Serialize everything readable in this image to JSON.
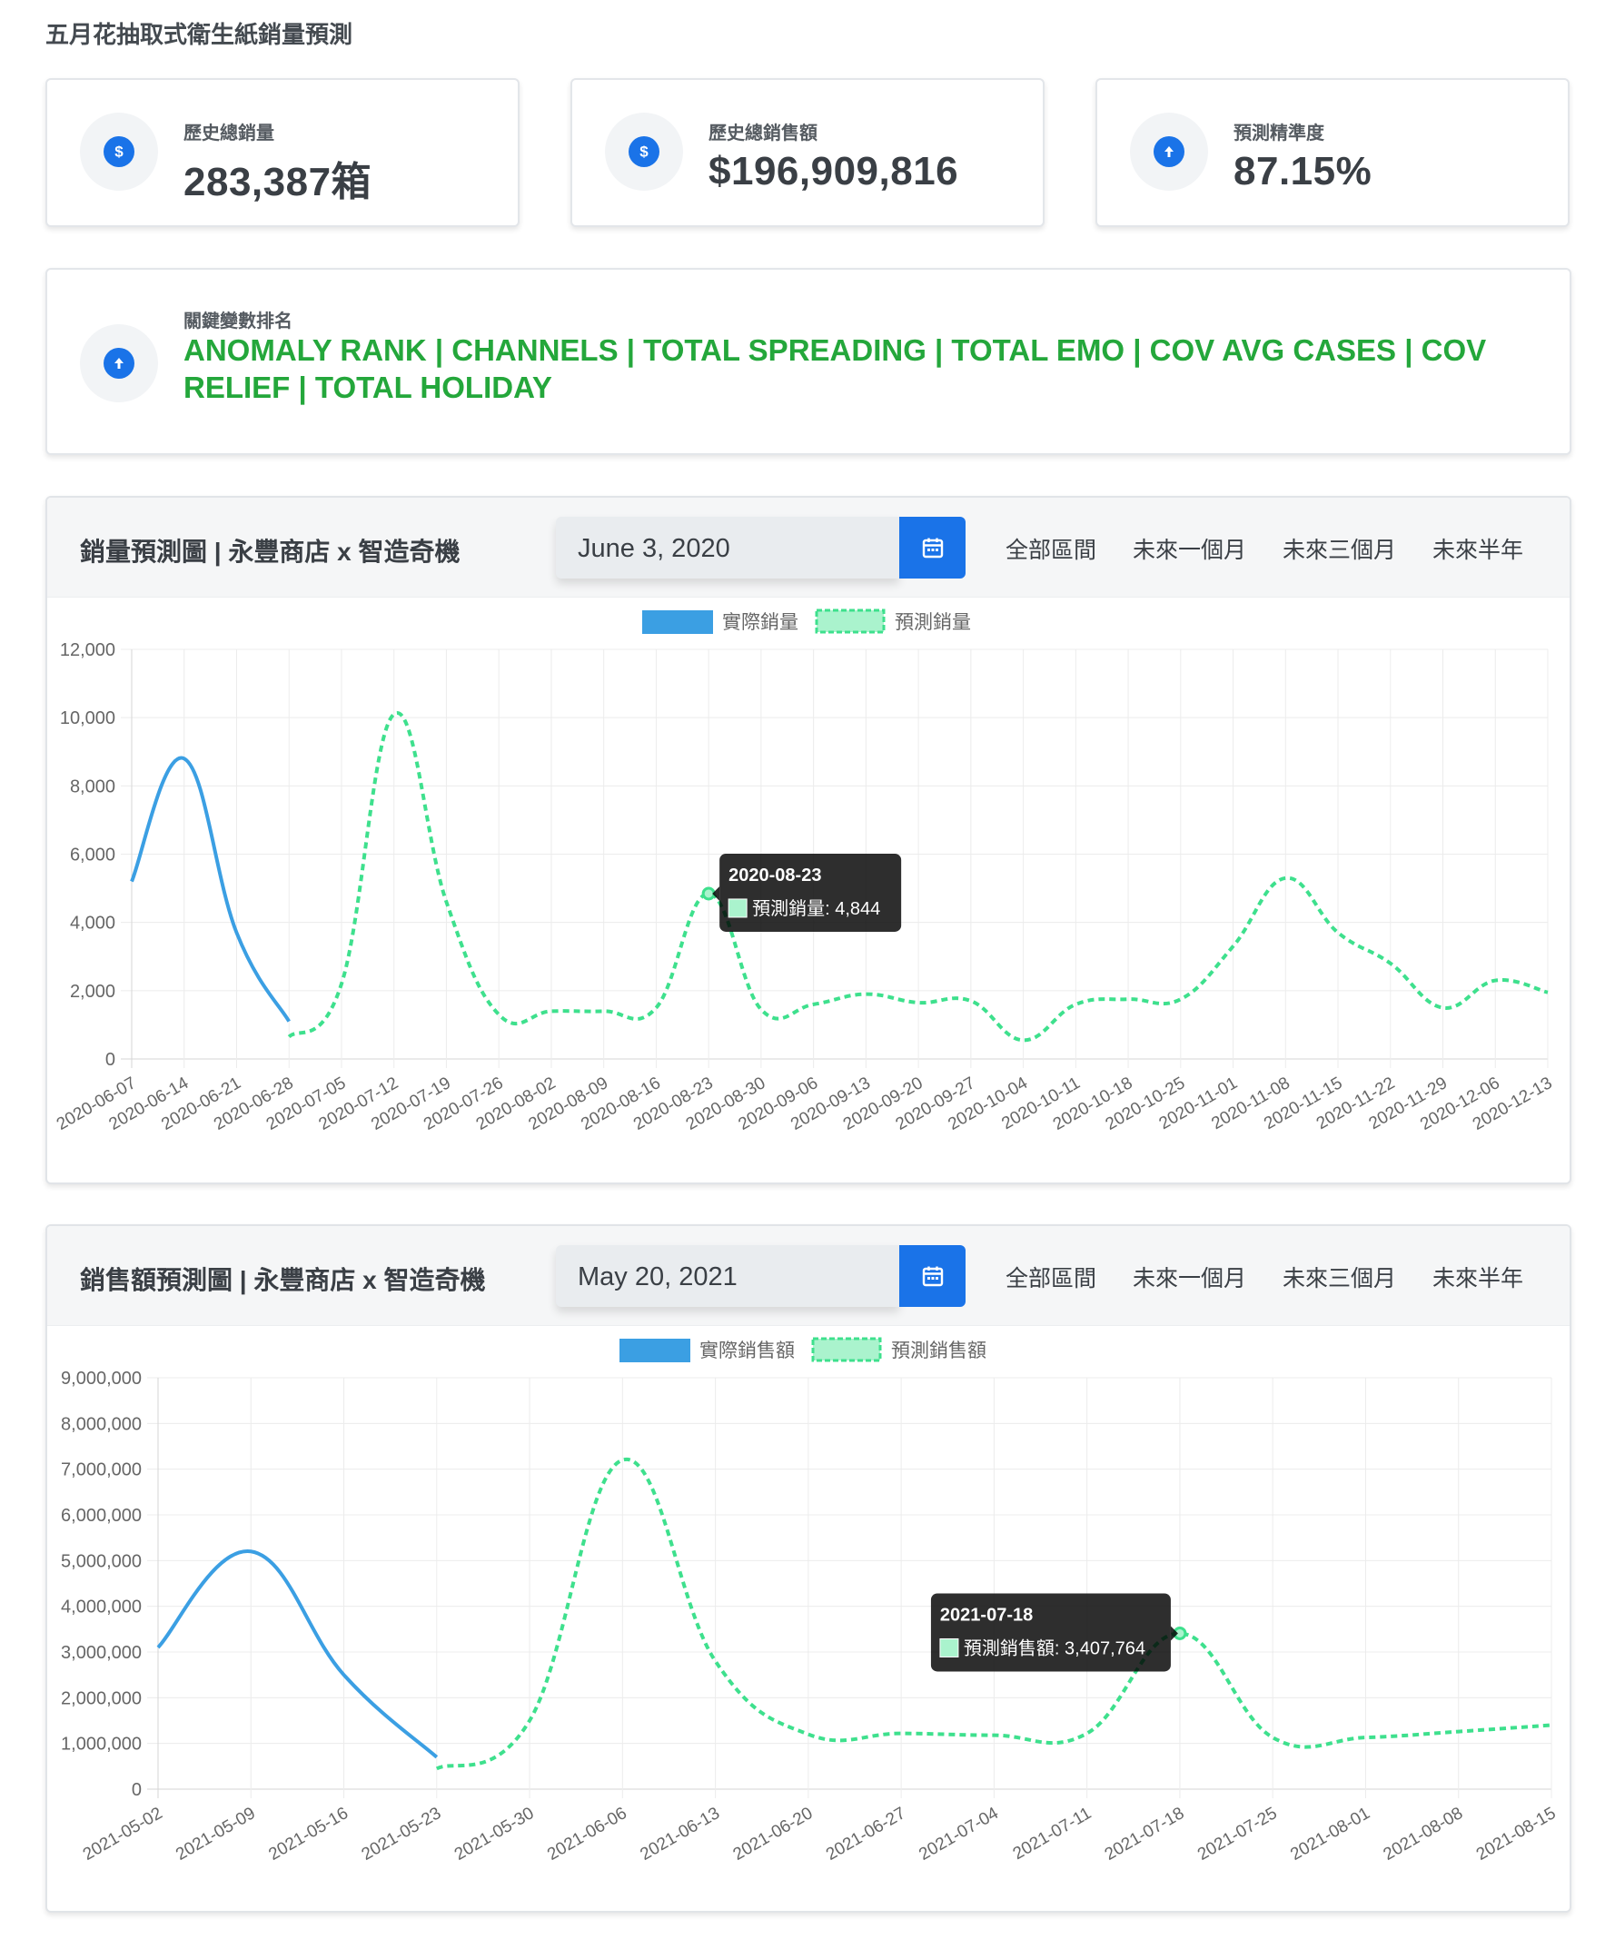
{
  "page": {
    "title": "五月花抽取式衛生紙銷量預測"
  },
  "kpis": [
    {
      "label": "歷史總銷量",
      "value": "283,387箱",
      "icon": "dollar-icon"
    },
    {
      "label": "歷史總銷售額",
      "value": "$196,909,816",
      "icon": "dollar-icon"
    },
    {
      "label": "預測精準度",
      "value": "87.15%",
      "icon": "arrow-up-icon"
    }
  ],
  "ranking": {
    "label": "關鍵變數排名",
    "text": "ANOMALY RANK | CHANNELS | TOTAL SPREADING | TOTAL EMO | COV AVG CASES | COV RELIEF | TOTAL HOLIDAY",
    "icon": "arrow-up-icon"
  },
  "colors": {
    "accent": "#1a73e8",
    "actual": "#3b9fe3",
    "forecast": "#3ee08d",
    "rank_text": "#24a73b"
  },
  "range_buttons": [
    "全部區間",
    "未來一個月",
    "未來三個月",
    "未來半年"
  ],
  "sales_chart": {
    "title": "銷量預測圖 | 永豐商店 x 智造奇機",
    "date": "June 3, 2020",
    "calendar_icon": "calendar-icon",
    "tooltip": {
      "date": "2020-08-23",
      "text": "預測銷量: 4,844"
    }
  },
  "revenue_chart": {
    "title": "銷售額預測圖 | 永豐商店 x 智造奇機",
    "date": "May 20, 2021",
    "calendar_icon": "calendar-icon",
    "tooltip": {
      "date": "2021-07-18",
      "text": "預測銷售額: 3,407,764"
    }
  },
  "chart_data": [
    {
      "type": "line",
      "legend": [
        "實際銷量",
        "預測銷量"
      ],
      "ylim": [
        0,
        12000
      ],
      "y_ticks": [
        "0",
        "2,000",
        "4,000",
        "6,000",
        "8,000",
        "10,000",
        "12,000"
      ],
      "x_ticks": [
        "2020-06-07",
        "2020-06-14",
        "2020-06-21",
        "2020-06-28",
        "2020-07-05",
        "2020-07-12",
        "2020-07-19",
        "2020-07-26",
        "2020-08-02",
        "2020-08-09",
        "2020-08-16",
        "2020-08-23",
        "2020-08-30",
        "2020-09-06",
        "2020-09-13",
        "2020-09-20",
        "2020-09-27",
        "2020-10-04",
        "2020-10-11",
        "2020-10-18",
        "2020-10-25",
        "2020-11-01",
        "2020-11-08",
        "2020-11-15",
        "2020-11-22",
        "2020-11-29",
        "2020-12-06",
        "2020-12-13"
      ],
      "series": [
        {
          "name": "實際銷量",
          "points": [
            [
              0,
              5200
            ],
            [
              1,
              8800
            ],
            [
              2,
              3700
            ],
            [
              3,
              1100
            ]
          ]
        },
        {
          "name": "預測銷量",
          "points": [
            [
              3,
              650
            ],
            [
              4,
              2200
            ],
            [
              5,
              10100
            ],
            [
              6,
              4600
            ],
            [
              7,
              1300
            ],
            [
              8,
              1400
            ],
            [
              9,
              1400
            ],
            [
              10,
              1500
            ],
            [
              11,
              4844
            ],
            [
              12,
              1450
            ],
            [
              13,
              1600
            ],
            [
              14,
              1900
            ],
            [
              15,
              1650
            ],
            [
              16,
              1700
            ],
            [
              17,
              550
            ],
            [
              18,
              1600
            ],
            [
              19,
              1750
            ],
            [
              20,
              1750
            ],
            [
              21,
              3300
            ],
            [
              22,
              5300
            ],
            [
              23,
              3700
            ],
            [
              24,
              2800
            ],
            [
              25,
              1500
            ],
            [
              26,
              2300
            ],
            [
              27,
              1950
            ]
          ]
        }
      ]
    },
    {
      "type": "line",
      "legend": [
        "實際銷售額",
        "預測銷售額"
      ],
      "ylim": [
        0,
        9000000
      ],
      "y_ticks": [
        "0",
        "1,000,000",
        "2,000,000",
        "3,000,000",
        "4,000,000",
        "5,000,000",
        "6,000,000",
        "7,000,000",
        "8,000,000",
        "9,000,000"
      ],
      "x_ticks": [
        "2021-05-02",
        "2021-05-09",
        "2021-05-16",
        "2021-05-23",
        "2021-05-30",
        "2021-06-06",
        "2021-06-13",
        "2021-06-20",
        "2021-06-27",
        "2021-07-04",
        "2021-07-11",
        "2021-07-18",
        "2021-07-25",
        "2021-08-01",
        "2021-08-08",
        "2021-08-15"
      ],
      "series": [
        {
          "name": "實際銷售額",
          "points": [
            [
              0,
              3100000
            ],
            [
              1,
              5200000
            ],
            [
              2,
              2500000
            ],
            [
              3,
              700000
            ]
          ]
        },
        {
          "name": "預測銷售額",
          "points": [
            [
              3,
              450000
            ],
            [
              4,
              1500000
            ],
            [
              5,
              7200000
            ],
            [
              6,
              2800000
            ],
            [
              7,
              1200000
            ],
            [
              8,
              1220000
            ],
            [
              9,
              1180000
            ],
            [
              10,
              1220000
            ],
            [
              11,
              3407764
            ],
            [
              12,
              1130000
            ],
            [
              13,
              1130000
            ],
            [
              14,
              1260000
            ],
            [
              15,
              1400000
            ]
          ]
        }
      ]
    }
  ]
}
